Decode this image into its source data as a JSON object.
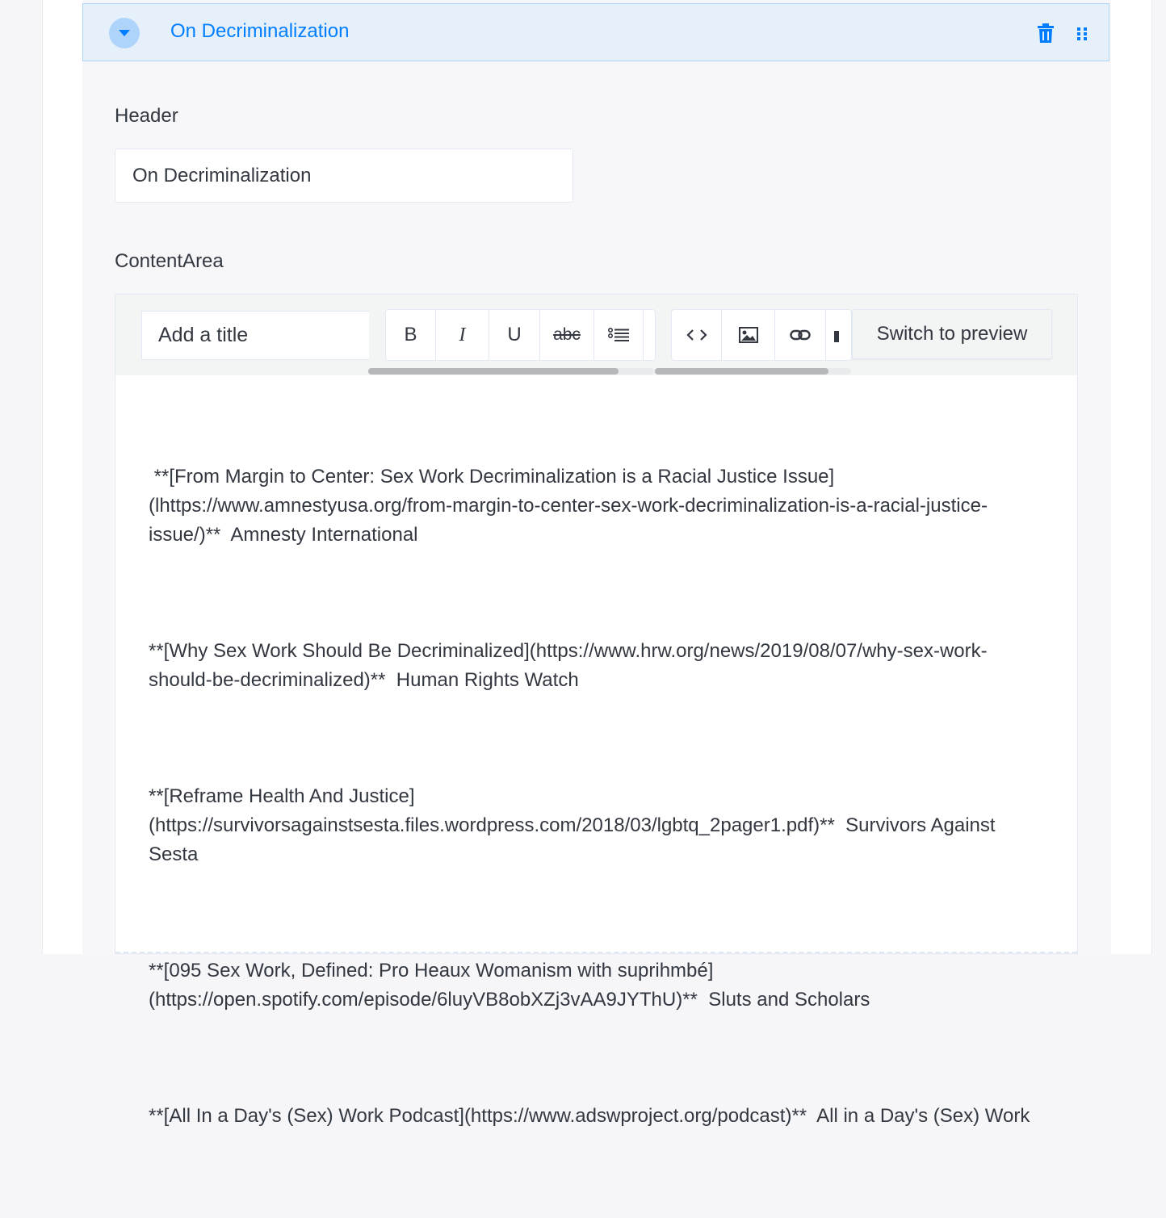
{
  "component": {
    "title": "On Decriminalization"
  },
  "fields": {
    "header_label": "Header",
    "header_value": "On Decriminalization",
    "content_label": "ContentArea"
  },
  "editor": {
    "title_placeholder": "Add a title",
    "toolbar": {
      "bold": "B",
      "italic": "I",
      "underline": "U",
      "strike": "abc"
    },
    "preview_label": "Switch to preview",
    "paragraphs": [
      " **[From Margin to Center: Sex Work Decriminalization is a Racial Justice Issue](lhttps://www.amnestyusa.org/from-margin-to-center-sex-work-decriminalization-is-a-racial-justice-issue/)**  Amnesty International",
      "**[Why Sex Work Should Be Decriminalized](https://www.hrw.org/news/2019/08/07/why-sex-work-should-be-decriminalized)**  Human Rights Watch",
      "**[Reframe Health And Justice](https://survivorsagainstsesta.files.wordpress.com/2018/03/lgbtq_2pager1.pdf)**  Survivors Against Sesta",
      "**[095 Sex Work, Defined: Pro Heaux Womanism with suprihmbé](https://open.spotify.com/episode/6luyVB8obXZj3vAA9JYThU)**  Sluts and Scholars",
      "**[All In a Day's (Sex) Work Podcast](https://www.adswproject.org/podcast)**  All in a Day's (Sex) Work"
    ]
  },
  "colors": {
    "accent": "#007eff",
    "header_bg": "#e6f0fb",
    "header_border": "#aed4fb"
  },
  "icons": [
    "chevron-down-icon",
    "trash-icon",
    "drag-handle-icon",
    "bullet-list-icon",
    "code-icon",
    "image-icon",
    "link-icon"
  ]
}
